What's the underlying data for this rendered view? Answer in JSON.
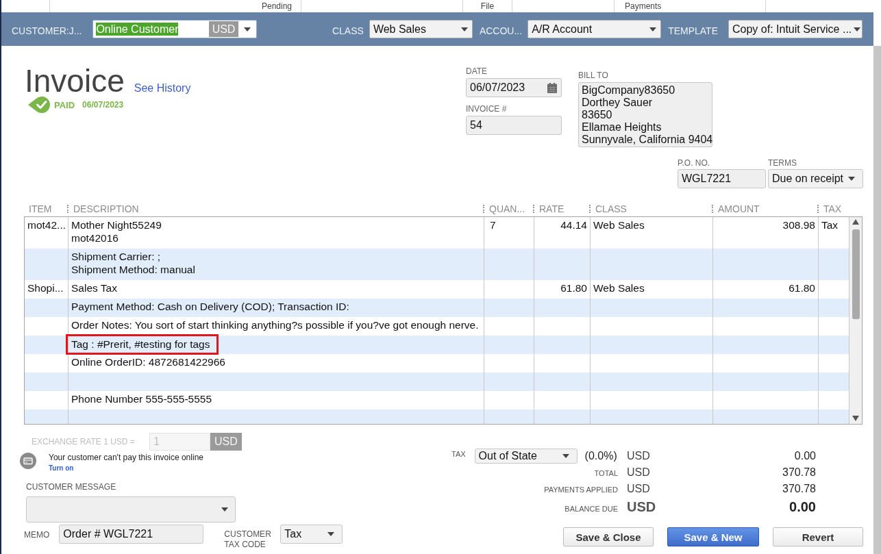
{
  "toolbar": [
    {
      "label": "Pending"
    },
    {
      "label": "File"
    },
    {
      "label": "Payments"
    }
  ],
  "header_bar": [
    {
      "kind": "customer",
      "label": "CUSTOMER:J...",
      "value": "Online Customer",
      "currency": "USD",
      "text_selected": true
    },
    {
      "kind": "combo",
      "label": "CLASS",
      "value": "Web Sales",
      "text_selected": false
    },
    {
      "kind": "combo",
      "label": "ACCOU...",
      "value": "A/R Account",
      "text_selected": false
    },
    {
      "kind": "combo",
      "label": "TEMPLATE",
      "value": "Copy of: Intuit Service ...",
      "text_selected": false
    }
  ],
  "invoice": {
    "title": "Invoice",
    "history_link": "See History",
    "status": {
      "kind": "paid",
      "label": "PAID",
      "date": "06/07/2023"
    }
  },
  "details": {
    "date": {
      "label": "DATE",
      "value": "06/07/2023"
    },
    "invoice_number": {
      "label": "INVOICE #",
      "value": "54"
    },
    "bill_to": {
      "label": "BILL TO",
      "lines": [
        "BigCompany83650",
        "Dorthey Sauer",
        "83650",
        "Ellamae Heights",
        "Sunnyvale, California 9404"
      ]
    },
    "po_number": {
      "label": "P.O. NO.",
      "value": "WGL7221"
    },
    "terms": {
      "label": "TERMS",
      "value": "Due on receipt"
    }
  },
  "table": {
    "columns": [
      "ITEM",
      "DESCRIPTION",
      "QUAN...",
      "RATE",
      "CLASS",
      "AMOUNT",
      "TAX"
    ],
    "rows": [
      {
        "item": "mot42...",
        "description": [
          "Mother Night55249",
          "mot42016"
        ],
        "quantity": "7",
        "rate": "44.14",
        "class": "Web Sales",
        "amount": "308.98",
        "tax": "Tax",
        "highlighted": false
      },
      {
        "description": [
          "Shipment Carrier: ;",
          "Shipment Method: manual"
        ],
        "highlighted": false
      },
      {
        "item": "Shopi...",
        "description": [
          "Sales Tax"
        ],
        "rate": "61.80",
        "class": "Web Sales",
        "amount": "61.80",
        "highlighted": false
      },
      {
        "description": [
          "Payment Method: Cash on Delivery (COD); Transaction ID:"
        ],
        "highlighted": false
      },
      {
        "description": [
          "Order Notes: You sort of start thinking anything?s possible if you?ve got enough nerve."
        ],
        "highlighted": false
      },
      {
        "description": [
          "Tag : #Prerit, #testing for tags"
        ],
        "highlighted": true
      },
      {
        "description": [
          "Online OrderID: 4872681422966"
        ],
        "highlighted": false
      },
      {
        "highlighted": false
      },
      {
        "description": [
          "Phone Number 555-555-5555"
        ],
        "highlighted": false
      },
      {
        "highlighted": false
      }
    ]
  },
  "footer": {
    "exchange_rate": {
      "label": "EXCHANGE RATE 1 USD =",
      "value": "1",
      "currency": "USD",
      "disabled": true
    },
    "online_payment": {
      "message": "Your customer can't pay this invoice online",
      "link": "Turn on"
    },
    "customer_message": {
      "label": "CUSTOMER MESSAGE"
    },
    "memo": {
      "label": "MEMO",
      "value": "Order # WGL7221"
    },
    "customer_tax_code": {
      "label": "CUSTOMER TAX CODE",
      "value": "Tax"
    }
  },
  "totals": {
    "tax": {
      "label": "TAX",
      "value": "Out of State",
      "rate": "(0.0%)",
      "currency": "USD",
      "amount": "0.00"
    },
    "lines": [
      {
        "kind": "line",
        "label": "TOTAL",
        "currency": "USD",
        "amount": "370.78"
      },
      {
        "kind": "line",
        "label": "PAYMENTS APPLIED",
        "currency": "USD",
        "amount": "370.78"
      },
      {
        "kind": "balance",
        "label": "BALANCE DUE",
        "currency": "USD",
        "amount": "0.00"
      }
    ]
  },
  "buttons": [
    {
      "label": "Save & Close",
      "primary": false
    },
    {
      "label": "Save & New",
      "primary": true
    },
    {
      "label": "Revert",
      "primary": false
    }
  ]
}
